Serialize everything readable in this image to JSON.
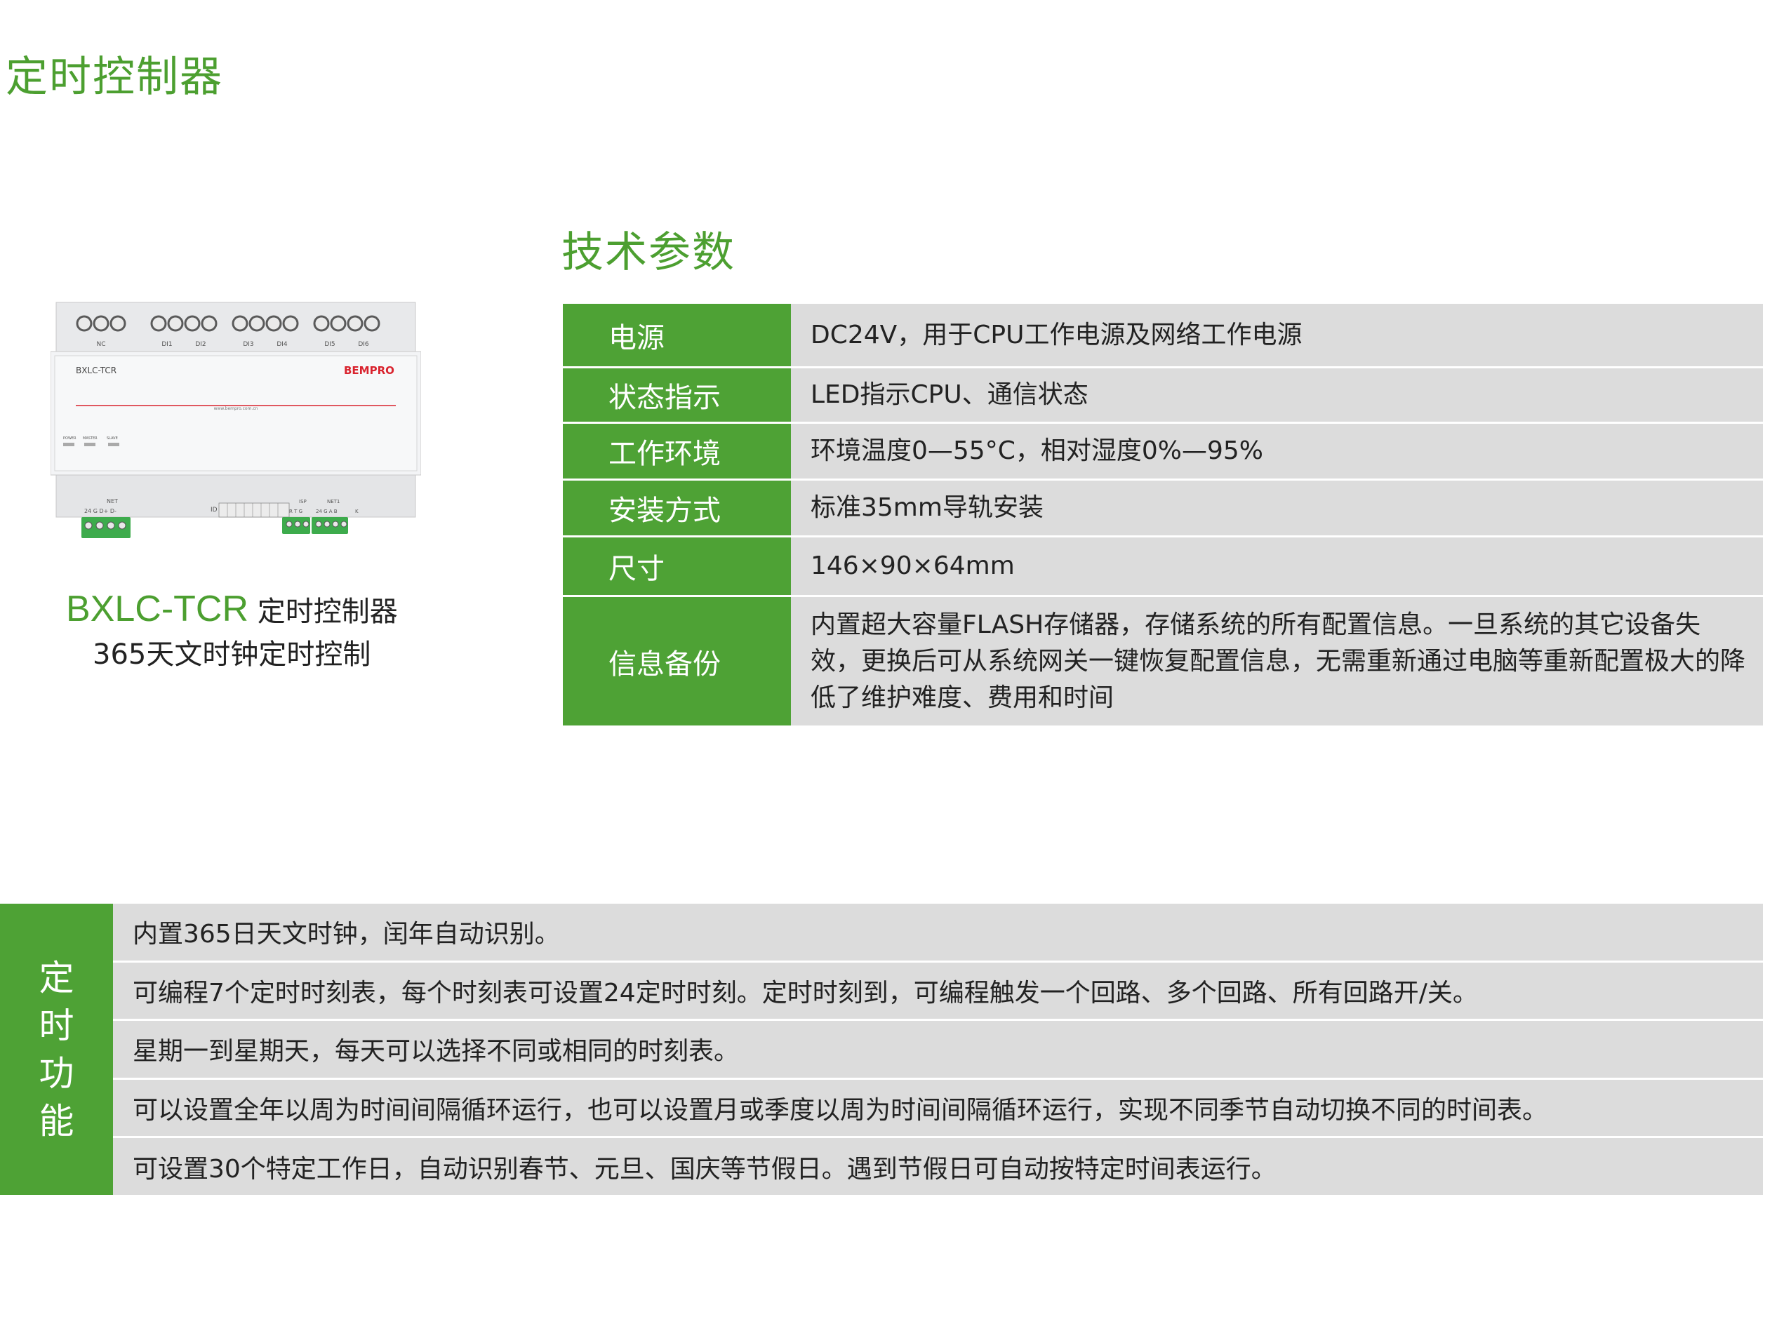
{
  "page": {
    "title": "定时控制器"
  },
  "product": {
    "model": "BXLC-TCR",
    "name": " 定时控制器",
    "description": "365天文时钟定时控制",
    "device_label": "BXLC-TCR",
    "brand": "BEMPRO",
    "website": "www.bempro.com.cn",
    "leds": [
      "POWER",
      "MASTER",
      "SLAVE"
    ],
    "top_terminals": [
      "NC",
      "DI1",
      "DI2",
      "DI3",
      "DI4",
      "DI5",
      "DI6"
    ],
    "bottom_net_label": "NET",
    "bottom_net_pins": "24  G  D+  D-",
    "isp_label": "ISP",
    "net1_label": "NET1",
    "isp_pins": "R  T  G",
    "net1_pins": "24  G  A  B",
    "k_label": "K",
    "id_label": "ID"
  },
  "specs": {
    "title": "技术参数",
    "rows": [
      {
        "label": "电源",
        "value": "DC24V，用于CPU工作电源及网络工作电源"
      },
      {
        "label": "状态指示",
        "value": "LED指示CPU、通信状态"
      },
      {
        "label": "工作环境",
        "value": "环境温度0—55°C，相对湿度0%—95%"
      },
      {
        "label": "安装方式",
        "value": "标准35mm导轨安装"
      },
      {
        "label": "尺寸",
        "value": "146×90×64mm"
      },
      {
        "label": "信息备份",
        "value": "内置超大容量FLASH存储器，存储系统的所有配置信息。一旦系统的其它设备失效，更换后可从系统网关一键恢复配置信息，无需重新通过电脑等重新配置极大的降低了维护难度、费用和时间"
      }
    ]
  },
  "functions": {
    "side_label": [
      "定",
      "时",
      "功",
      "能"
    ],
    "items": [
      "内置365日天文时钟，闰年自动识别。",
      "可编程7个定时时刻表，每个时刻表可设置24定时时刻。定时时刻到，可编程触发一个回路、多个回路、所有回路开/关。",
      "星期一到星期天，每天可以选择不同或相同的时刻表。",
      "可以设置全年以周为时间间隔循环运行，也可以设置月或季度以周为时间间隔循环运行，实现不同季节自动切换不同的时间表。",
      "可设置30个特定工作日，自动识别春节、元旦、国庆等节假日。遇到节假日可自动按特定时间表运行。"
    ]
  },
  "colors": {
    "green": "#4ea235",
    "gray": "#dcdcdc",
    "brand_red": "#d9232e"
  }
}
